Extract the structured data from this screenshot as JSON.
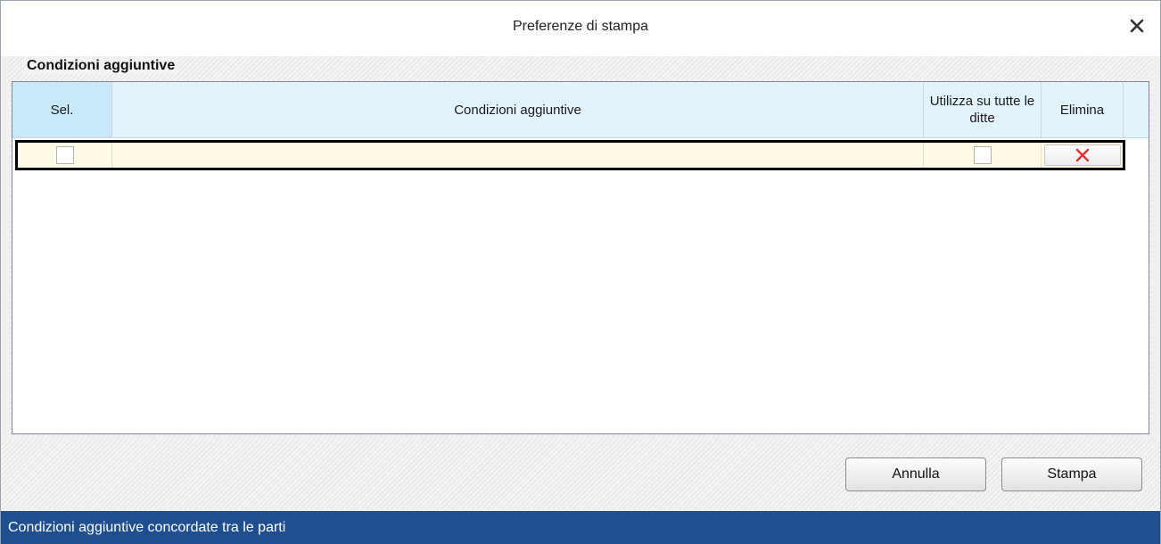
{
  "window": {
    "title": "Preferenze di stampa",
    "close_icon": "close-icon"
  },
  "group": {
    "title": "Condizioni aggiuntive"
  },
  "grid": {
    "columns": {
      "sel": "Sel.",
      "condizioni": "Condizioni aggiuntive",
      "utilizza": "Utilizza su tutte le ditte",
      "elimina": "Elimina"
    },
    "rows": [
      {
        "selected": false,
        "condizione": "",
        "utilizza_su_tutte": false,
        "delete_icon": "delete-x-icon"
      }
    ]
  },
  "buttons": {
    "annulla": "Annulla",
    "stampa": "Stampa"
  },
  "status": {
    "text": "Condizioni aggiuntive concordate tra le parti"
  },
  "colors": {
    "header_bg": "#e3f3fb",
    "selected_header_bg": "#c9e9f8",
    "row_bg": "#fffbe6",
    "status_bar": "#1f4f8f",
    "delete_x": "#e0302a"
  }
}
